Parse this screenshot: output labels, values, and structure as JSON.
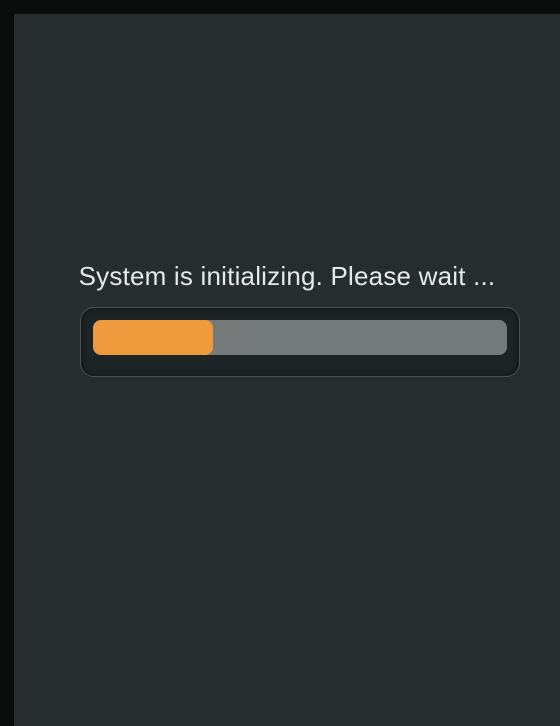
{
  "status": {
    "message": "System is initializing. Please wait ..."
  },
  "progress": {
    "fraction": 0.29,
    "fill_color": "#f09a3e",
    "track_color": "#747979"
  },
  "colors": {
    "background": "#252d2e",
    "text": "#e6e9e9"
  }
}
